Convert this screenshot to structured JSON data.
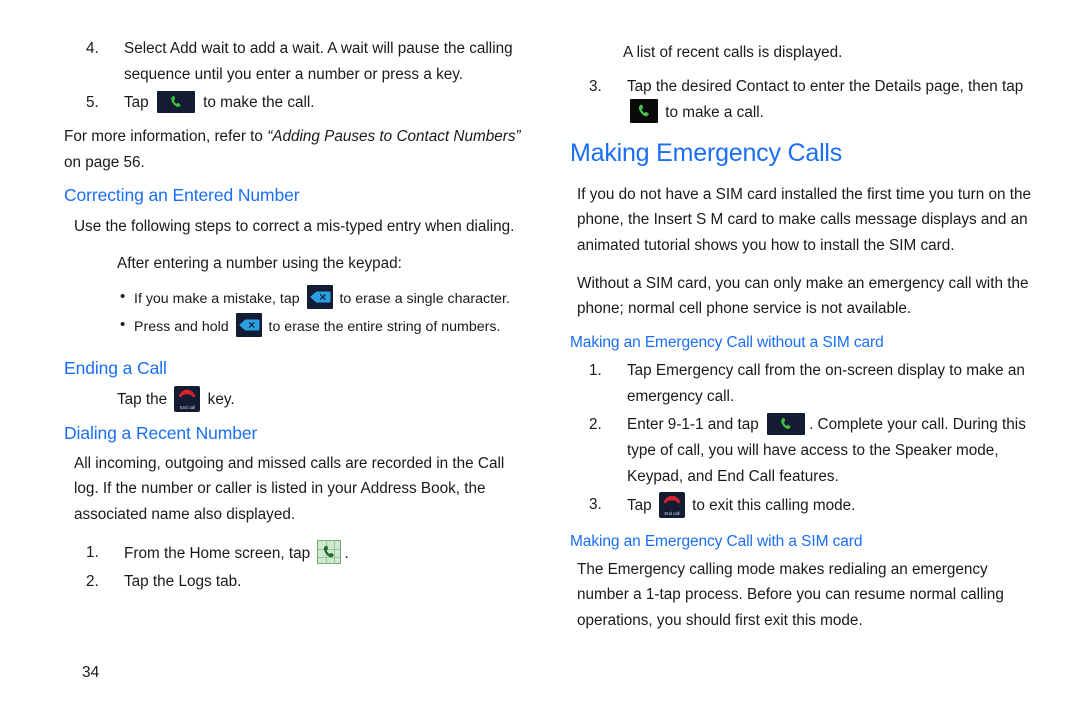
{
  "document": {
    "page_number": "34",
    "accent_color": "#1a6ef5",
    "text_color": "#1a1a1a",
    "background_color": "#ffffff"
  },
  "left_column": {
    "steps_top": [
      {
        "num": "4.",
        "text_before": "Select ",
        "emphasis": "Add wait",
        "text_after": " to add a wait. A wait will pause the calling sequence until you enter a number or press a key."
      },
      {
        "num": "5.",
        "text_before": "Tap ",
        "icon": "call-key-icon",
        "text_after": " to make the call."
      }
    ],
    "note": {
      "prefix": "For more information, refer to ",
      "italic": "“Adding Pauses to Contact Numbers”",
      "suffix": " on page 56."
    },
    "section_correcting": {
      "title": "Correcting an Entered Number",
      "intro": "Use the following steps to correct a mis-typed entry when dialing.",
      "sub_intro": "After entering a number using the keypad:",
      "bullets": [
        {
          "text_before": "If you make a mistake, tap ",
          "icon": "backspace-key-icon",
          "text_after": " to erase a single character."
        },
        {
          "text_before": "Press and hold ",
          "icon": "backspace-key-icon",
          "text_after": " to erase the entire string of numbers."
        }
      ]
    },
    "section_ending": {
      "title": "Ending a Call",
      "line_before": "Tap the ",
      "icon": "end-call-key-icon",
      "icon_label": "End call",
      "line_after": " key."
    },
    "section_dialing": {
      "title": "Dialing a Recent Number",
      "paragraph_before": "All incoming, outgoing and missed calls are recorded in the ",
      "paragraph_emphasis": "Call log",
      "paragraph_after": ". If the number or caller is listed in your Address Book, the associated name also displayed.",
      "steps": [
        {
          "num": "1.",
          "text_before": "From the Home screen, tap ",
          "icon": "phone-launcher-icon",
          "text_after": "."
        },
        {
          "num": "2.",
          "text_before": "Tap the ",
          "emphasis": "Logs",
          "text_after": " tab."
        }
      ]
    }
  },
  "right_column": {
    "continuation_note": "A list of recent calls is displayed.",
    "step_three": {
      "num": "3.",
      "text_before": "Tap the desired Contact to enter the ",
      "emphasis": "Details",
      "text_mid": " page, then tap ",
      "icon": "call-key-black-icon",
      "text_after": " to make a call."
    },
    "section_emergency": {
      "title": "Making Emergency Calls",
      "paragraph_one_before": "If you do not have a SIM card installed the first time you turn on the phone, the ",
      "paragraph_one_emphasis": "Insert S M card to make calls",
      "paragraph_one_after": " message displays and an animated tutorial shows you how to install the SIM card.",
      "paragraph_two": "Without a SIM card, you can only make an emergency call with the phone; normal cell phone service is not available."
    },
    "section_without_sim": {
      "title": "Making an Emergency Call without a SIM card",
      "steps": [
        {
          "num": "1.",
          "text": "Tap Emergency call from the on-screen display to make an emergency call."
        },
        {
          "num": "2.",
          "text_before": "Enter 9-1-1 and tap ",
          "icon": "call-key-icon",
          "text_after": ". Complete your call. During this type of call, you will have access to the Speaker mode, Keypad, and End Call features."
        },
        {
          "num": "3.",
          "text_before": "Tap ",
          "icon": "end-call-key-icon",
          "icon_label": "End call",
          "text_after": " to exit this calling mode."
        }
      ]
    },
    "section_with_sim": {
      "title": "Making an Emergency Call with a SIM card",
      "paragraph": "The Emergency calling mode makes redialing an emergency number a 1-tap process. Before you can resume normal calling operations, you should first exit this mode."
    }
  }
}
